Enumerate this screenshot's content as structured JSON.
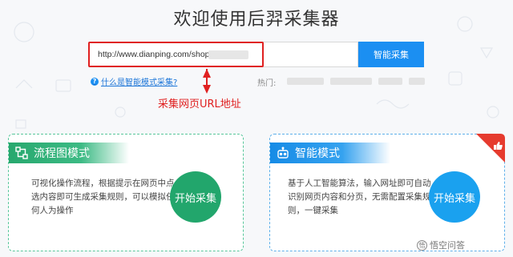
{
  "header": {
    "title": "欢迎使用后羿采集器"
  },
  "url_input": {
    "value": "http://www.dianping.com/shop/"
  },
  "smart_button_label": "智能采集",
  "help_link_text": "什么是智能模式采集?",
  "hot_label": "热门:",
  "annotation_text": "采集网页URL地址",
  "flow_mode": {
    "title": "流程图模式",
    "description": "可视化操作流程，根据提示在网页中点选内容即可生成采集规则，可以模拟任何人为操作",
    "start_label": "开始采集",
    "icon": "flowchart-icon",
    "accent": "#22a66c"
  },
  "smart_mode": {
    "title": "智能模式",
    "description": "基于人工智能算法，输入网址即可自动识别网页内容和分页，无需配置采集规则，一键采集",
    "start_label": "开始采集",
    "icon": "robot-icon",
    "accent": "#1aa1ef",
    "badge_icon": "thumbs-up-icon"
  },
  "watermark": "悟空问答",
  "colors": {
    "annotation_red": "#e02020",
    "button_blue": "#1b8ff2"
  }
}
